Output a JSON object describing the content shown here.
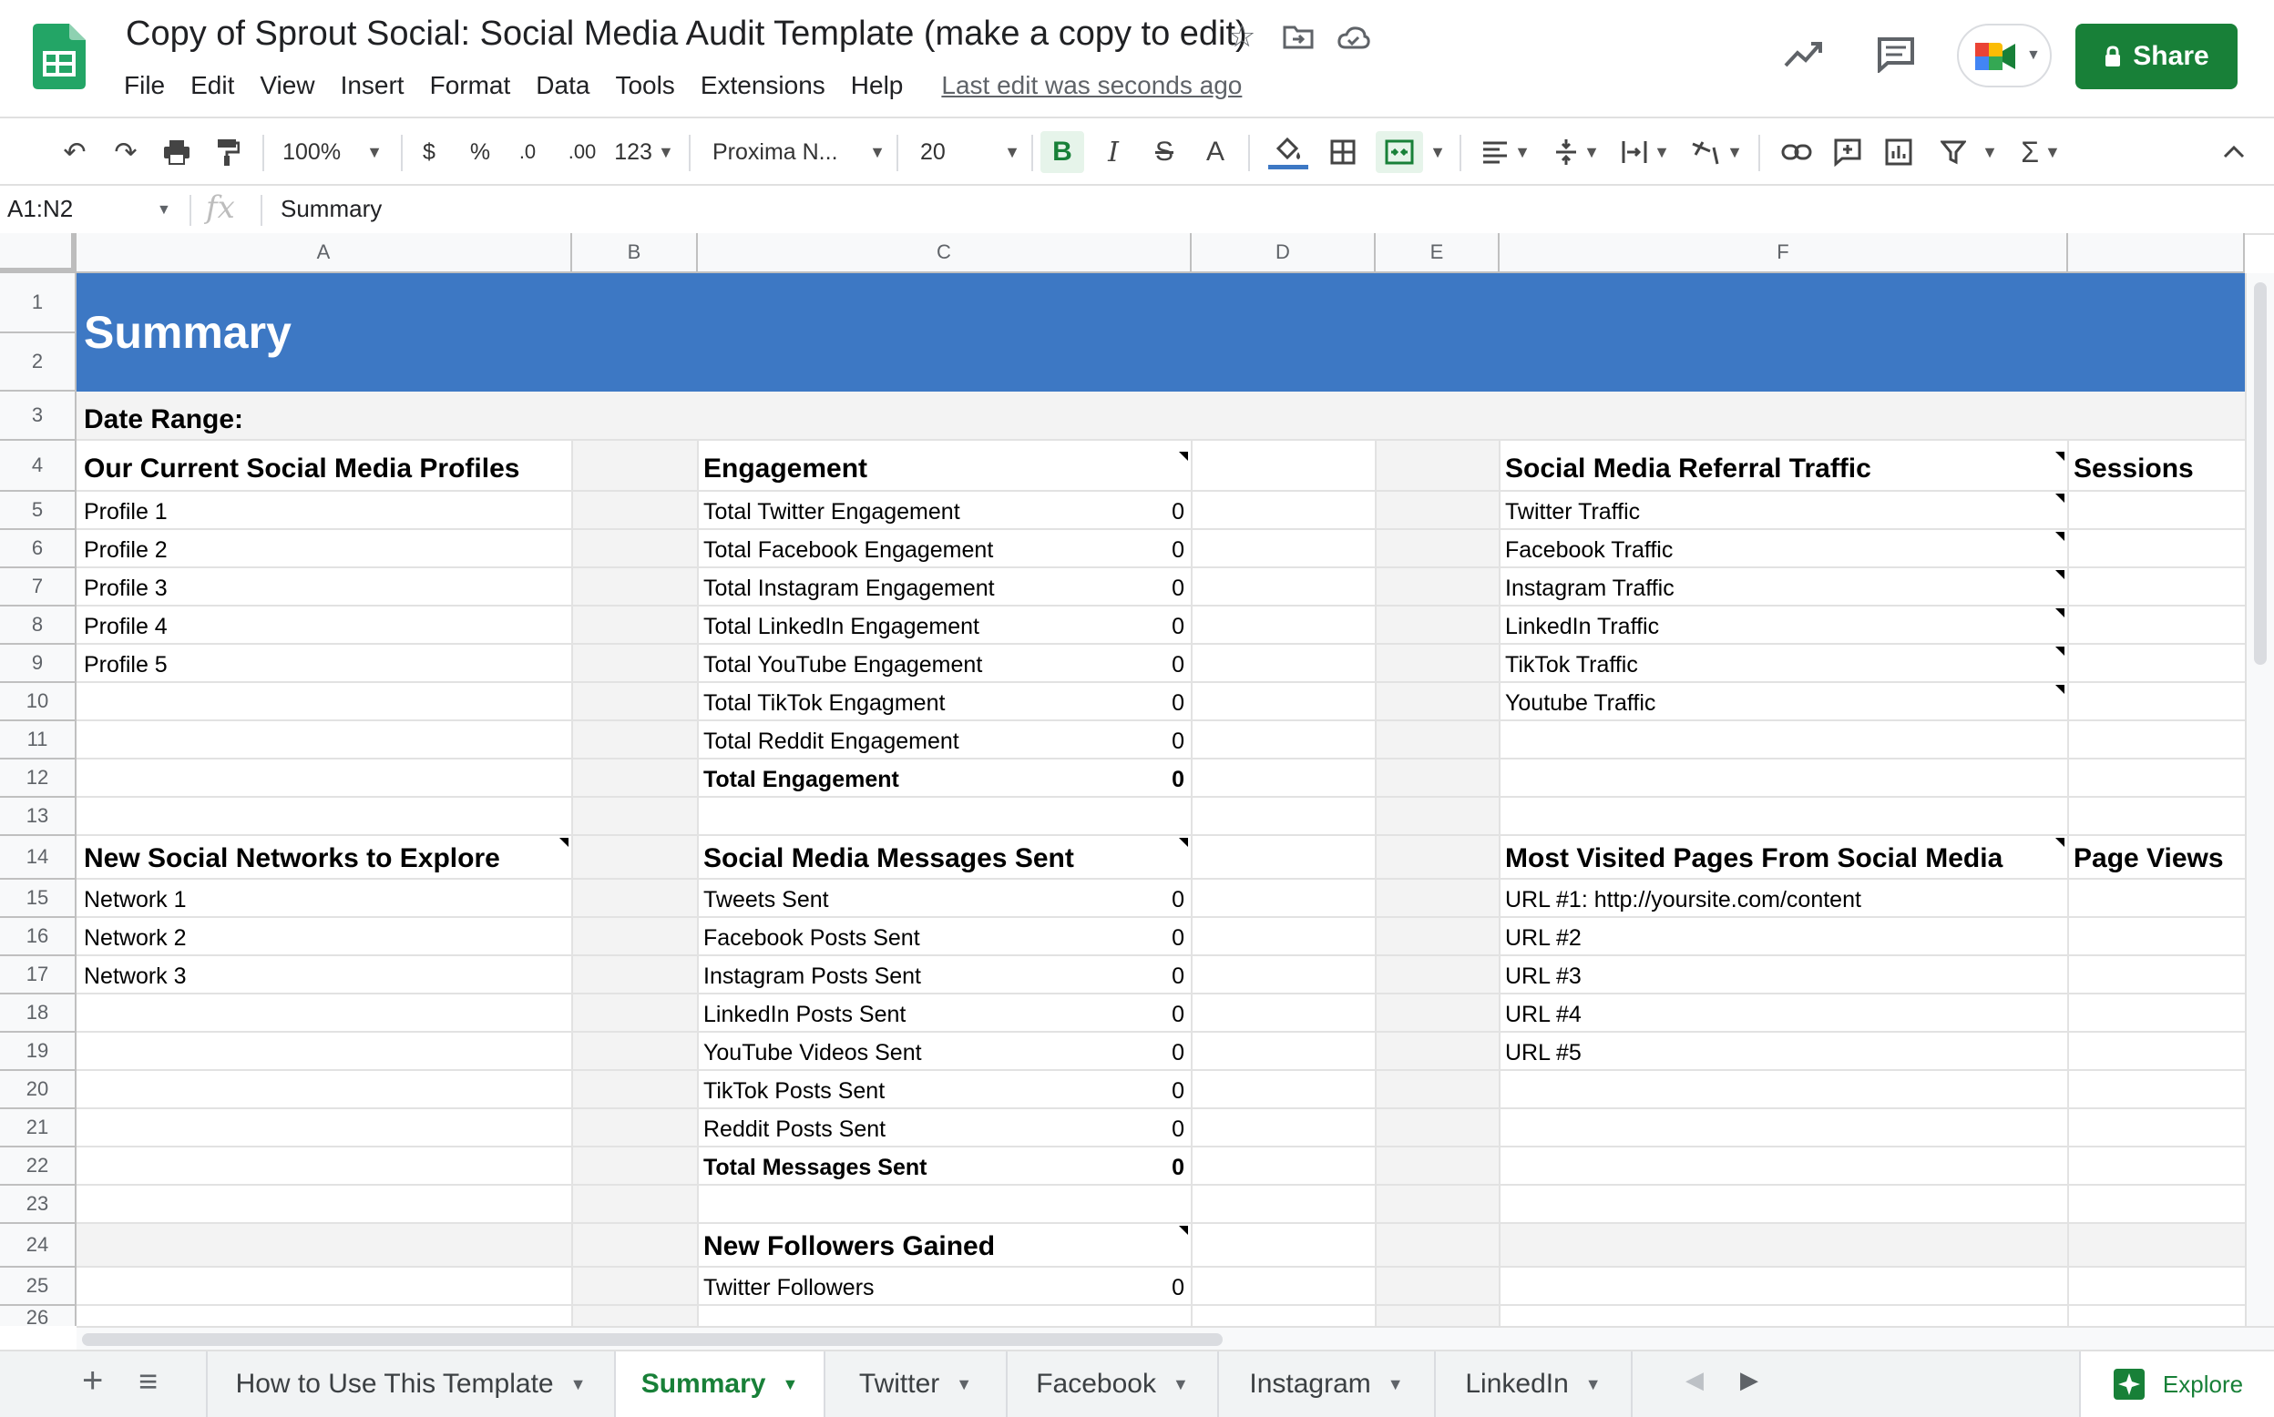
{
  "document": {
    "title": "Copy of Sprout Social: Social Media Audit Template (make a copy to edit)",
    "last_edit": "Last edit was seconds ago",
    "menu": [
      "File",
      "Edit",
      "View",
      "Insert",
      "Format",
      "Data",
      "Tools",
      "Extensions",
      "Help"
    ],
    "share_label": "Share"
  },
  "toolbar": {
    "zoom": "100%",
    "currency": "$",
    "percent": "%",
    "decrease_decimal": ".0",
    "increase_decimal": ".00",
    "number_format": "123",
    "font": "Proxima N...",
    "font_size": "20",
    "bold": "B",
    "italic": "I",
    "strike": "S",
    "text_color": "A"
  },
  "formula_bar": {
    "cell_ref": "A1:N2",
    "fx": "fx",
    "value": "Summary"
  },
  "columns": [
    "A",
    "B",
    "C",
    "D",
    "E",
    "F"
  ],
  "rows": [
    "1",
    "2",
    "3",
    "4",
    "5",
    "6",
    "7",
    "8",
    "9",
    "10",
    "11",
    "12",
    "13",
    "14",
    "15",
    "16",
    "17",
    "18",
    "19",
    "20",
    "21",
    "22",
    "23",
    "24",
    "25",
    "26"
  ],
  "sheet": {
    "summary_title": "Summary",
    "date_range_label": "Date Range:",
    "profiles": {
      "header": "Our Current Social Media Profiles",
      "items": [
        "Profile 1",
        "Profile 2",
        "Profile 3",
        "Profile 4",
        "Profile 5"
      ]
    },
    "networks": {
      "header": "New Social Networks to Explore",
      "items": [
        "Network 1",
        "Network 2",
        "Network 3"
      ]
    },
    "engagement": {
      "header": "Engagement",
      "items": [
        {
          "label": "Total Twitter Engagement",
          "value": "0"
        },
        {
          "label": "Total Facebook Engagement",
          "value": "0"
        },
        {
          "label": "Total Instagram Engagement",
          "value": "0"
        },
        {
          "label": "Total LinkedIn Engagement",
          "value": "0"
        },
        {
          "label": "Total YouTube Engagement",
          "value": "0"
        },
        {
          "label": "Total TikTok Engagment",
          "value": "0"
        },
        {
          "label": "Total Reddit Engagement",
          "value": "0"
        },
        {
          "label": "Total Engagement",
          "value": "0"
        }
      ]
    },
    "messages": {
      "header": "Social Media Messages Sent",
      "items": [
        {
          "label": "Tweets Sent",
          "value": "0"
        },
        {
          "label": "Facebook Posts Sent",
          "value": "0"
        },
        {
          "label": "Instagram Posts Sent",
          "value": "0"
        },
        {
          "label": "LinkedIn Posts Sent",
          "value": "0"
        },
        {
          "label": "YouTube Videos Sent",
          "value": "0"
        },
        {
          "label": "TikTok Posts Sent",
          "value": "0"
        },
        {
          "label": "Reddit Posts Sent",
          "value": "0"
        },
        {
          "label": "Total Messages Sent",
          "value": "0"
        }
      ]
    },
    "followers": {
      "header": "New Followers Gained",
      "items": [
        {
          "label": "Twitter Followers",
          "value": "0"
        }
      ]
    },
    "referral": {
      "header": "Social Media Referral Traffic",
      "sessions_header": "Sessions",
      "items": [
        "Twitter Traffic",
        "Facebook Traffic",
        "Instagram Traffic",
        "LinkedIn Traffic",
        "TikTok Traffic",
        "Youtube Traffic"
      ]
    },
    "pages": {
      "header": "Most Visited Pages From Social Media",
      "views_header": "Page Views",
      "items": [
        "URL #1: http://yoursite.com/content",
        "URL #2",
        "URL #3",
        "URL #4",
        "URL #5"
      ]
    }
  },
  "tabs": [
    {
      "label": "How to Use This Template",
      "active": false
    },
    {
      "label": "Summary",
      "active": true
    },
    {
      "label": "Twitter",
      "active": false
    },
    {
      "label": "Facebook",
      "active": false
    },
    {
      "label": "Instagram",
      "active": false
    },
    {
      "label": "LinkedIn",
      "active": false
    }
  ],
  "explore_label": "Explore",
  "colors": {
    "header_band": "#3d78c4",
    "accent_green": "#188038",
    "section_gray": "#f3f3f3"
  }
}
